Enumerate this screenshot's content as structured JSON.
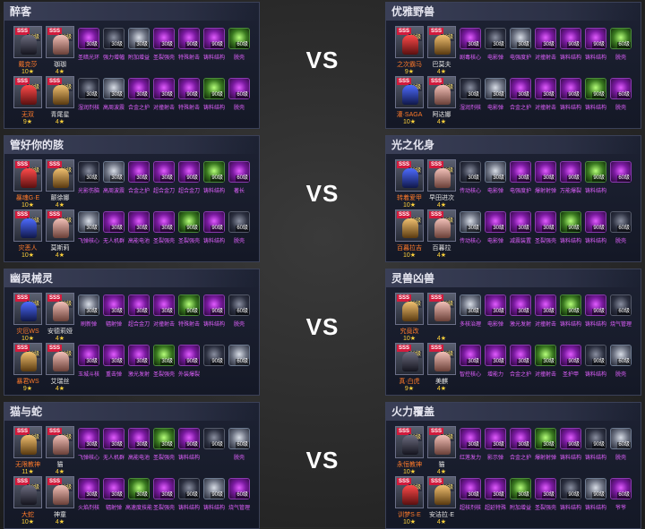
{
  "vs_label": "VS",
  "matches": [
    {
      "left": {
        "team": "醉客",
        "rows": [
          {
            "c1": {
              "name": "戴克莎",
              "stars": "10★",
              "level": "60级"
            },
            "c2": {
              "name": "珈珈",
              "stars": "4★",
              "level": "60级"
            },
            "items": [
              {
                "label": "圣暗光环",
                "level": "30级"
              },
              {
                "label": "强力增幅",
                "level": "30级"
              },
              {
                "label": "附加增益",
                "level": "30级"
              },
              {
                "label": "圣裂强壳",
                "level": "30级"
              },
              {
                "label": "特殊射击",
                "level": "90级"
              },
              {
                "label": "铸料结构",
                "level": "90级"
              },
              {
                "label": "脱壳",
                "level": "60级"
              }
            ]
          },
          {
            "c1": {
              "name": "无双",
              "stars": "9★",
              "level": "60级"
            },
            "c2": {
              "name": "青尾星",
              "stars": "4★",
              "level": "60级"
            },
            "items": [
              {
                "label": "湿润剂核",
                "level": "30级"
              },
              {
                "label": "高周波震",
                "level": "30级"
              },
              {
                "label": "合金之护",
                "level": "30级"
              },
              {
                "label": "对撞射击",
                "level": "30级"
              },
              {
                "label": "特殊射击",
                "level": "90级"
              },
              {
                "label": "铸料结构",
                "level": "90级"
              },
              {
                "label": "脱壳",
                "level": "60级"
              }
            ]
          }
        ]
      },
      "right": {
        "team": "优雅野兽",
        "rows": [
          {
            "c1": {
              "name": "之次霸马",
              "stars": "9★",
              "level": "60级"
            },
            "c2": {
              "name": "巴莫夫",
              "stars": "4★",
              "level": "60级"
            },
            "items": [
              {
                "label": "剧毒核心",
                "level": "30级"
              },
              {
                "label": "电影弹",
                "level": "30级"
              },
              {
                "label": "电强度护",
                "level": "30级"
              },
              {
                "label": "对撞射击",
                "level": "30级"
              },
              {
                "label": "铸料结构",
                "level": "90级"
              },
              {
                "label": "铸料结构",
                "level": "90级"
              },
              {
                "label": "脱壳",
                "level": "60级"
              }
            ]
          },
          {
            "c1": {
              "name": "灌·SAGA",
              "stars": "10★",
              "level": "60级"
            },
            "c2": {
              "name": "阿达娜",
              "stars": "4★",
              "level": "60级"
            },
            "items": [
              {
                "label": "湿润剂核",
                "level": "30级"
              },
              {
                "label": "电影弹",
                "level": "30级"
              },
              {
                "label": "合金之护",
                "level": "30级"
              },
              {
                "label": "对撞射击",
                "level": "30级"
              },
              {
                "label": "铸料结构",
                "level": "90级"
              },
              {
                "label": "铸料结构",
                "level": "90级"
              },
              {
                "label": "脱壳",
                "level": "60级"
              }
            ]
          }
        ]
      }
    },
    {
      "left": {
        "team": "管好你的胲",
        "rows": [
          {
            "c1": {
              "name": "暴魂G·E",
              "stars": "10★",
              "level": "60级"
            },
            "c2": {
              "name": "颤徐娜",
              "stars": "4★",
              "level": "60级"
            },
            "items": [
              {
                "label": "光影伤脑",
                "level": "30级"
              },
              {
                "label": "高周波震",
                "level": "30级"
              },
              {
                "label": "合金之护",
                "level": "30级"
              },
              {
                "label": "超合金刀",
                "level": "30级"
              },
              {
                "label": "超合金刀",
                "level": "90级"
              },
              {
                "label": "铸料结构",
                "level": "90级"
              },
              {
                "label": "著长",
                "level": "60级"
              }
            ]
          },
          {
            "c1": {
              "name": "灾恶人",
              "stars": "10★",
              "level": "60级"
            },
            "c2": {
              "name": "莫斯莉",
              "stars": "4★",
              "level": "60级"
            },
            "items": [
              {
                "label": "飞弹核心",
                "level": "30级"
              },
              {
                "label": "无人机群",
                "level": "30级"
              },
              {
                "label": "高能电池",
                "level": "30级"
              },
              {
                "label": "圣裂强壳",
                "level": "30级"
              },
              {
                "label": "圣裂强壳",
                "level": "90级"
              },
              {
                "label": "铸料结构",
                "level": "90级"
              },
              {
                "label": "脱壳",
                "level": "60级"
              }
            ]
          }
        ]
      },
      "right": {
        "team": "光之化身",
        "rows": [
          {
            "c1": {
              "name": "转着爱甲",
              "stars": "10★",
              "level": "60级"
            },
            "c2": {
              "name": "早田进次",
              "stars": "4★",
              "level": "60级"
            },
            "items": [
              {
                "label": "传动核心",
                "level": "30级"
              },
              {
                "label": "电影弹",
                "level": "30级"
              },
              {
                "label": "电强度护",
                "level": "30级"
              },
              {
                "label": "爆射射弹",
                "level": "30级"
              },
              {
                "label": "万能爆裂",
                "level": "90级"
              },
              {
                "label": "铸料结构",
                "level": "90级"
              },
              {
                "label": "",
                "level": "60级"
              }
            ]
          },
          {
            "c1": {
              "name": "百暮拉吉",
              "stars": "10★",
              "level": "60级"
            },
            "c2": {
              "name": "百暮拉",
              "stars": "4★",
              "level": "60级"
            },
            "items": [
              {
                "label": "传动核心",
                "level": "30级"
              },
              {
                "label": "电影弹",
                "level": "30级"
              },
              {
                "label": "减震装置",
                "level": "30级"
              },
              {
                "label": "圣裂强壳",
                "level": "30级"
              },
              {
                "label": "铸料结构",
                "level": "90级"
              },
              {
                "label": "铸料结构",
                "level": "90级"
              },
              {
                "label": "脱壳",
                "level": "60级"
              }
            ]
          }
        ]
      }
    },
    {
      "left": {
        "team": "幽灵械灵",
        "rows": [
          {
            "c1": {
              "name": "灾厄WS",
              "stars": "10★",
              "level": "60级"
            },
            "c2": {
              "name": "安德莉娅",
              "stars": "4★",
              "level": "60级"
            },
            "items": [
              {
                "label": "刷新弹",
                "level": "30级"
              },
              {
                "label": "辐射弹",
                "level": "30级"
              },
              {
                "label": "超合金刀",
                "level": "30级"
              },
              {
                "label": "对撞射击",
                "level": "30级"
              },
              {
                "label": "特殊射击",
                "level": "90级"
              },
              {
                "label": "铸料结构",
                "level": "90级"
              },
              {
                "label": "脱壳",
                "level": "60级"
              }
            ]
          },
          {
            "c1": {
              "name": "暴君WS",
              "stars": "9★",
              "level": "60级"
            },
            "c2": {
              "name": "艾瑞丝",
              "stars": "4★",
              "level": "60级"
            },
            "items": [
              {
                "label": "玉城斗核",
                "level": "30级"
              },
              {
                "label": "重击弹",
                "level": "30级"
              },
              {
                "label": "激光发射",
                "level": "30级"
              },
              {
                "label": "圣裂强壳",
                "level": "30级"
              },
              {
                "label": "外装爆裂",
                "level": "90级"
              },
              {
                "label": "",
                "level": "90级"
              },
              {
                "label": "",
                "level": "60级"
              }
            ]
          }
        ]
      },
      "right": {
        "team": "灵兽凶兽",
        "rows": [
          {
            "c1": {
              "name": "究竟改",
              "stars": "10★",
              "level": "60级"
            },
            "c2": {
              "name": "",
              "stars": "4★",
              "level": "60级"
            },
            "items": [
              {
                "label": "多核治理",
                "level": "30级"
              },
              {
                "label": "电影弹",
                "level": "30级"
              },
              {
                "label": "激光发射",
                "level": "30级"
              },
              {
                "label": "对撞射击",
                "level": "30级"
              },
              {
                "label": "铸料结构",
                "level": "90级"
              },
              {
                "label": "铸料结构",
                "level": "90级"
              },
              {
                "label": "烧气管理",
                "level": "60级"
              }
            ]
          },
          {
            "c1": {
              "name": "真·白虎",
              "stars": "9★",
              "level": "60级"
            },
            "c2": {
              "name": "美麒",
              "stars": "4★",
              "level": "60级"
            },
            "items": [
              {
                "label": "智控核心",
                "level": "30级"
              },
              {
                "label": "增能力",
                "level": "30级"
              },
              {
                "label": "合金之护",
                "level": "30级"
              },
              {
                "label": "对撞射击",
                "level": "30级"
              },
              {
                "label": "圣护甲",
                "level": "90级"
              },
              {
                "label": "铸料结构",
                "level": "90级"
              },
              {
                "label": "脱壳",
                "level": "60级"
              }
            ]
          }
        ]
      }
    },
    {
      "left": {
        "team": "猫与蛇",
        "rows": [
          {
            "c1": {
              "name": "无限教神",
              "stars": "11★",
              "level": "60级"
            },
            "c2": {
              "name": "猫",
              "stars": "4★",
              "level": "60级"
            },
            "items": [
              {
                "label": "飞弹核心",
                "level": "30级"
              },
              {
                "label": "无人机群",
                "level": "30级"
              },
              {
                "label": "高能电池",
                "level": "30级"
              },
              {
                "label": "圣裂强壳",
                "level": "30级"
              },
              {
                "label": "铸料结构",
                "level": "90级"
              },
              {
                "label": "",
                "level": "90级"
              },
              {
                "label": "脱壳",
                "level": "60级"
              }
            ]
          },
          {
            "c1": {
              "name": "大蛇",
              "stars": "10★",
              "level": "60级"
            },
            "c2": {
              "name": "神童",
              "stars": "4★",
              "level": "60级"
            },
            "items": [
              {
                "label": "火焰剂核",
                "level": "30级"
              },
              {
                "label": "辐射弹",
                "level": "30级"
              },
              {
                "label": "高速度技能",
                "level": "30级"
              },
              {
                "label": "圣裂强壳",
                "level": "30级"
              },
              {
                "label": "铸料结构",
                "level": "90级"
              },
              {
                "label": "铸料结构",
                "level": "90级"
              },
              {
                "label": "烧气管理",
                "level": "60级"
              }
            ]
          }
        ]
      },
      "right": {
        "team": "火力覆盖",
        "rows": [
          {
            "c1": {
              "name": "永恒教神",
              "stars": "10★",
              "level": "60级"
            },
            "c2": {
              "name": "猫",
              "stars": "4★",
              "level": "60级"
            },
            "items": [
              {
                "label": "红莲发力",
                "level": "30级"
              },
              {
                "label": "影示弹",
                "level": "30级"
              },
              {
                "label": "合金之护",
                "level": "30级"
              },
              {
                "label": "爆射射弹",
                "level": "30级"
              },
              {
                "label": "铸料结构",
                "level": "90级"
              },
              {
                "label": "铸料结构",
                "level": "90级"
              },
              {
                "label": "脱壳",
                "level": "60级"
              }
            ]
          },
          {
            "c1": {
              "name": "训梦S·E",
              "stars": "10★",
              "level": "60级"
            },
            "c2": {
              "name": "安洁拉·E",
              "stars": "4★",
              "level": "60级"
            },
            "items": [
              {
                "label": "超核剂核",
                "level": "30级"
              },
              {
                "label": "超延特殊",
                "level": "30级"
              },
              {
                "label": "附加增益",
                "level": "30级"
              },
              {
                "label": "圣裂强壳",
                "level": "30级"
              },
              {
                "label": "铸料结构",
                "level": "90级"
              },
              {
                "label": "铸料结构",
                "level": "90级"
              },
              {
                "label": "爷爷",
                "level": "60级"
              }
            ]
          }
        ]
      }
    }
  ]
}
